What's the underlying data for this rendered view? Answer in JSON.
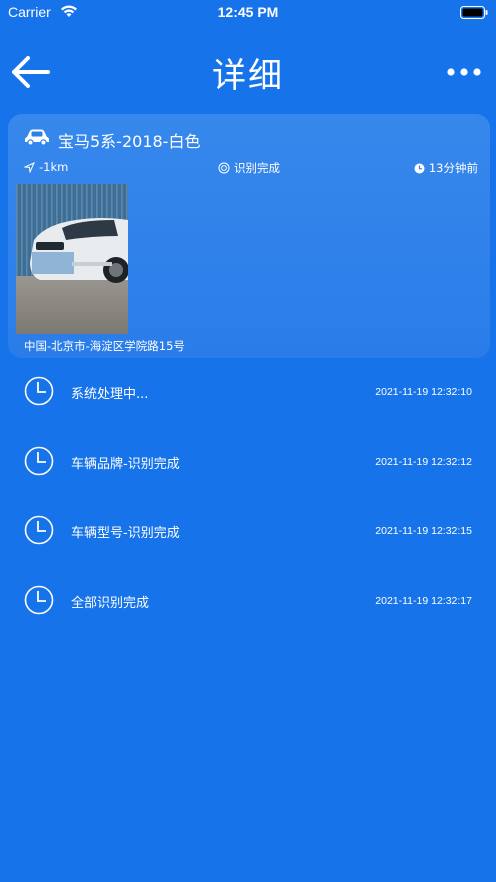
{
  "status_bar": {
    "carrier": "Carrier",
    "time": "12:45 PM"
  },
  "nav": {
    "title": "详细",
    "back_icon": "back-arrow-icon",
    "more_icon": "more-icon"
  },
  "card": {
    "title": "宝马5系-2018-白色",
    "distance": "-1km",
    "status": "识别完成",
    "time_ago": "13分钟前",
    "address": "中国-北京市-海淀区学院路15号"
  },
  "timeline": [
    {
      "label": "系统处理中...",
      "time": "2021-11-19 12:32:10"
    },
    {
      "label": "车辆品牌-识别完成",
      "time": "2021-11-19 12:32:12"
    },
    {
      "label": "车辆型号-识别完成",
      "time": "2021-11-19 12:32:15"
    },
    {
      "label": "全部识别完成",
      "time": "2021-11-19 12:32:17"
    }
  ],
  "colors": {
    "background": "#1673ea",
    "card": "#2d81ea",
    "text": "#ffffff"
  }
}
